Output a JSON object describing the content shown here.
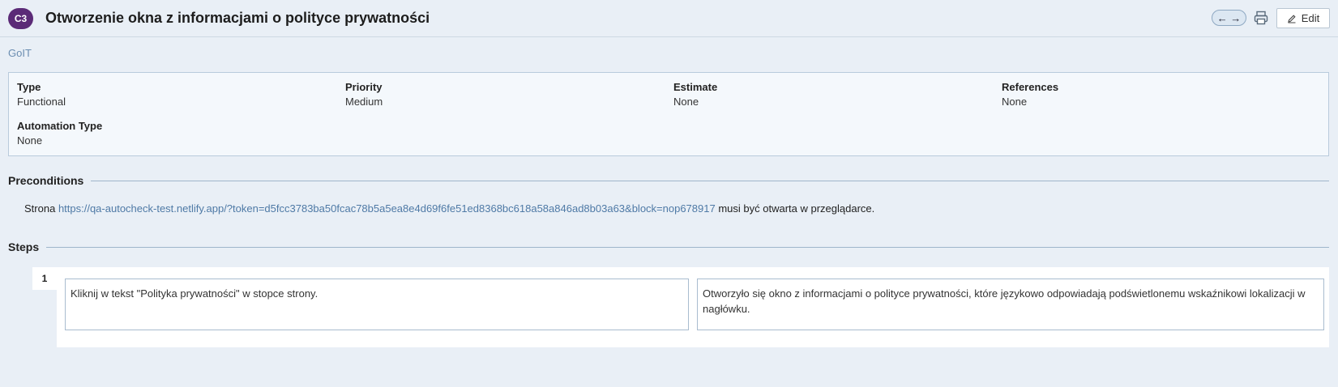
{
  "header": {
    "case_id": "C3",
    "title": "Otworzenie okna z informacjami o polityce prywatności",
    "prev_icon": "arrow-left-icon",
    "next_icon": "arrow-right-icon",
    "print_icon": "printer-icon",
    "edit_label": "Edit",
    "edit_icon": "pencil-icon",
    "badge_color": "#5b2a77"
  },
  "project": {
    "name": "GoIT"
  },
  "fields": {
    "type": {
      "label": "Type",
      "value": "Functional"
    },
    "priority": {
      "label": "Priority",
      "value": "Medium"
    },
    "estimate": {
      "label": "Estimate",
      "value": "None"
    },
    "references": {
      "label": "References",
      "value": "None"
    },
    "automation_type": {
      "label": "Automation Type",
      "value": "None"
    }
  },
  "preconditions": {
    "heading": "Preconditions",
    "prefix": "Strona",
    "link": "https://qa-autocheck-test.netlify.app/?token=d5fcc3783ba50fcac78b5a5ea8e4d69f6fe51ed8368bc618a58a846ad8b03a63&block=nop678917",
    "suffix": "musi być otwarta w przeglądarce."
  },
  "steps": {
    "heading": "Steps",
    "items": [
      {
        "number": "1",
        "content": "Kliknij w tekst \"Polityka prywatności\" w stopce strony.",
        "expected": "Otworzyło się okno z informacjami o polityce prywatności, które językowo odpowiadają podświetlonemu wskaźnikowi lokalizacji w nagłówku."
      }
    ]
  }
}
